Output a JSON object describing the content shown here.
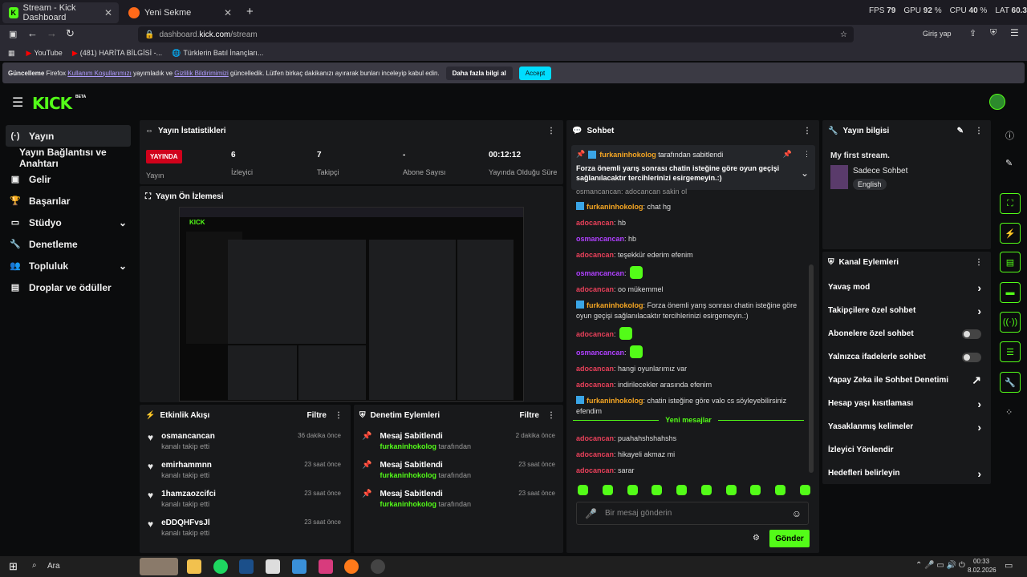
{
  "browser": {
    "tabs": [
      {
        "title": "Stream - Kick Dashboard"
      },
      {
        "title": "Yeni Sekme"
      }
    ],
    "url_host": "dashboard.",
    "url_domain": "kick.com",
    "url_path": "/stream",
    "login": "Giriş yap",
    "bookmarks": [
      "YouTube",
      "(481) HARİTA BİLGİSİ -...",
      "Türklerin Batıl İnançları..."
    ]
  },
  "overlay": {
    "fps_label": "FPS",
    "fps": "79",
    "gpu_label": "GPU",
    "gpu": "92",
    "cpu_label": "CPU",
    "cpu": "40",
    "lat_label": "LAT",
    "lat": "60.3",
    "pct": "%"
  },
  "notice": {
    "pre": "Güncelleme",
    "t1": "Firefox",
    "link1": "Kullanım Koşullarımızı",
    "t2": "yayımladık ve",
    "link2": "Gizlilik Bildirimimizi",
    "t3": "güncelledik. Lütfen birkaç dakikanızı ayırarak bunları inceleyip kabul edin.",
    "more": "Daha fazla bilgi al",
    "accept": "Accept"
  },
  "kick": {
    "logo": "KICK",
    "beta": "BETA"
  },
  "sidebar": [
    {
      "label": "Yayın",
      "icon": "(·)"
    },
    {
      "label": "Yayın Bağlantısı ve Anahtarı",
      "icon": ""
    },
    {
      "label": "Gelir",
      "icon": "▣"
    },
    {
      "label": "Başarılar",
      "icon": "🏆"
    },
    {
      "label": "Stüdyo",
      "icon": "▭"
    },
    {
      "label": "Denetleme",
      "icon": "🔧"
    },
    {
      "label": "Topluluk",
      "icon": "👥"
    },
    {
      "label": "Droplar ve ödüller",
      "icon": "▤"
    }
  ],
  "stats": {
    "title": "Yayın İstatistikleri",
    "live": "YAYINDA",
    "live_l": "Yayın",
    "viewers": "6",
    "viewers_l": "İzleyici",
    "followers": "7",
    "followers_l": "Takipçi",
    "subs": "-",
    "subs_l": "Abone Sayısı",
    "time": "00:12:12",
    "time_l": "Yayında Olduğu Süre"
  },
  "preview": {
    "title": "Yayın Ön İzlemesi"
  },
  "activity": {
    "title": "Etkinlik Akışı",
    "filter": "Filtre",
    "items": [
      {
        "name": "osmancancan",
        "action": "kanalı takip etti",
        "time": "36 dakika önce"
      },
      {
        "name": "emirhammnn",
        "action": "kanalı takip etti",
        "time": "23 saat önce"
      },
      {
        "name": "1hamzaozcifci",
        "action": "kanalı takip etti",
        "time": "23 saat önce"
      },
      {
        "name": "eDDQHFvsJl",
        "action": "kanalı takip etti",
        "time": "23 saat önce"
      }
    ]
  },
  "moderation": {
    "title": "Denetim Eylemleri",
    "filter": "Filtre",
    "items": [
      {
        "name": "Mesaj Sabitlendi",
        "by": "furkaninhokolog",
        "suffix": "tarafından",
        "time": "2 dakika önce"
      },
      {
        "name": "Mesaj Sabitlendi",
        "by": "furkaninhokolog",
        "suffix": "tarafından",
        "time": "23 saat önce"
      },
      {
        "name": "Mesaj Sabitlendi",
        "by": "furkaninhokolog",
        "suffix": "tarafından",
        "time": "23 saat önce"
      }
    ]
  },
  "chat": {
    "title": "Sohbet",
    "pinned_by": "furkaninhokolog",
    "pinned_suffix": "tarafından sabitlendi",
    "pinned_msg": "Forza önemli yarış sonrası chatin isteğine göre oyun geçişi sağlanılacaktır tercihlerinizi esirgemeyin.:)",
    "partial": "osmancancan: adocancan sakin ol",
    "messages": [
      {
        "user": "furkaninhokolog",
        "c": "o",
        "text": "chat hg",
        "badge": true
      },
      {
        "user": "adocancan",
        "c": "r",
        "text": "hb"
      },
      {
        "user": "osmancancan",
        "c": "p",
        "text": "hb"
      },
      {
        "user": "adocancan",
        "c": "r",
        "text": "teşekkür ederim efenim"
      },
      {
        "user": "osmancancan",
        "c": "p",
        "text": "",
        "emote": true
      },
      {
        "user": "adocancan",
        "c": "r",
        "text": "oo mükemmel"
      },
      {
        "user": "furkaninhokolog",
        "c": "o",
        "text": "Forza önemli yarış sonrası chatin isteğine göre oyun geçişi sağlanılacaktır tercihlerinizi esirgemeyin.:)",
        "badge": true
      },
      {
        "user": "adocancan",
        "c": "r",
        "text": "",
        "emote": true
      },
      {
        "user": "osmancancan",
        "c": "p",
        "text": "",
        "emote": true
      },
      {
        "user": "adocancan",
        "c": "r",
        "text": "hangi oyunlarımız var"
      },
      {
        "user": "adocancan",
        "c": "r",
        "text": "indirilecekler arasında efenim"
      },
      {
        "user": "furkaninhokolog",
        "c": "o",
        "text": "chatin isteğine göre valo cs söyleyebilirsiniz efendim",
        "badge": true
      }
    ],
    "new_label": "Yeni mesajlar",
    "new_messages": [
      {
        "user": "adocancan",
        "text": "puahahshshahshs"
      },
      {
        "user": "adocancan",
        "text": "hikayeli akmaz mi"
      },
      {
        "user": "adocancan",
        "text": "sarar"
      }
    ],
    "placeholder": "Bir mesaj gönderin",
    "send": "Gönder"
  },
  "info": {
    "title": "Yayın bilgisi",
    "stream_title": "My first stream.",
    "category": "Sadece Sohbet",
    "lang": "English"
  },
  "actions": {
    "title": "Kanal Eylemleri",
    "items": [
      {
        "label": "Yavaş mod",
        "ctl": "›"
      },
      {
        "label": "Takipçilere özel sohbet",
        "ctl": "›"
      },
      {
        "label": "Abonelere özel sohbet",
        "ctl": "toggle"
      },
      {
        "label": "Yalnızca ifadelerle sohbet",
        "ctl": "toggle"
      },
      {
        "label": "Yapay Zeka ile Sohbet Denetimi",
        "ctl": "↗"
      },
      {
        "label": "Hesap yaşı kısıtlaması",
        "ctl": "›"
      },
      {
        "label": "Yasaklanmış kelimeler",
        "ctl": "›"
      },
      {
        "label": "İzleyici Yönlendir",
        "ctl": ""
      },
      {
        "label": "Hedefleri belirleyin",
        "ctl": "›"
      }
    ]
  },
  "taskbar": {
    "search": "Ara",
    "time": "00:33",
    "date": "8.02.2026"
  }
}
